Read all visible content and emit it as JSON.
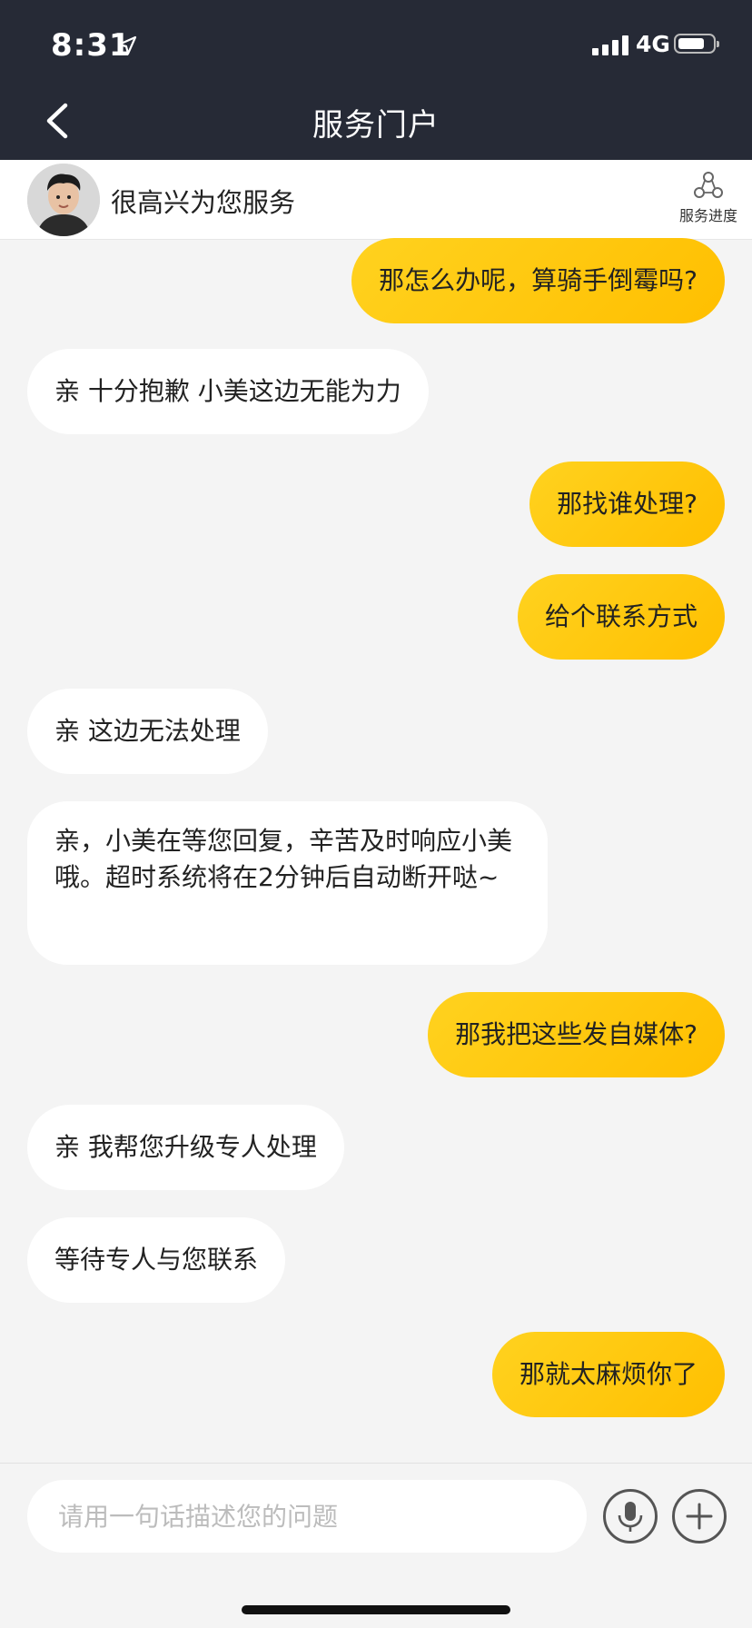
{
  "status_bar": {
    "time": "8:31",
    "network": "4G"
  },
  "nav": {
    "title": "服务门户"
  },
  "agent": {
    "greeting": "很高兴为您服务",
    "progress_label": "服务进度"
  },
  "messages": [
    {
      "side": "out",
      "text": "那怎么办呢，算骑手倒霉吗?"
    },
    {
      "side": "in",
      "text": "亲 十分抱歉 小美这边无能为力"
    },
    {
      "side": "out",
      "text": "那找谁处理?"
    },
    {
      "side": "out",
      "text": "给个联系方式"
    },
    {
      "side": "in",
      "text": "亲 这边无法处理"
    },
    {
      "side": "in",
      "text": "亲，小美在等您回复，辛苦及时响应小美哦。超时系统将在2分钟后自动断开哒~"
    },
    {
      "side": "out",
      "text": "那我把这些发自媒体?"
    },
    {
      "side": "in",
      "text": "亲 我帮您升级专人处理"
    },
    {
      "side": "in",
      "text": "等待专人与您联系"
    },
    {
      "side": "out",
      "text": "那就太麻烦你了"
    }
  ],
  "composer": {
    "placeholder": "请用一句话描述您的问题"
  },
  "icons": {
    "back": "chevron-left-icon",
    "progress": "progress-nodes-icon",
    "mic": "microphone-icon",
    "plus": "plus-icon",
    "location": "location-arrow-icon"
  },
  "colors": {
    "header_bg": "#262a36",
    "bubble_out": "#ffc800",
    "bubble_in": "#ffffff",
    "chat_bg": "#f4f4f4"
  }
}
